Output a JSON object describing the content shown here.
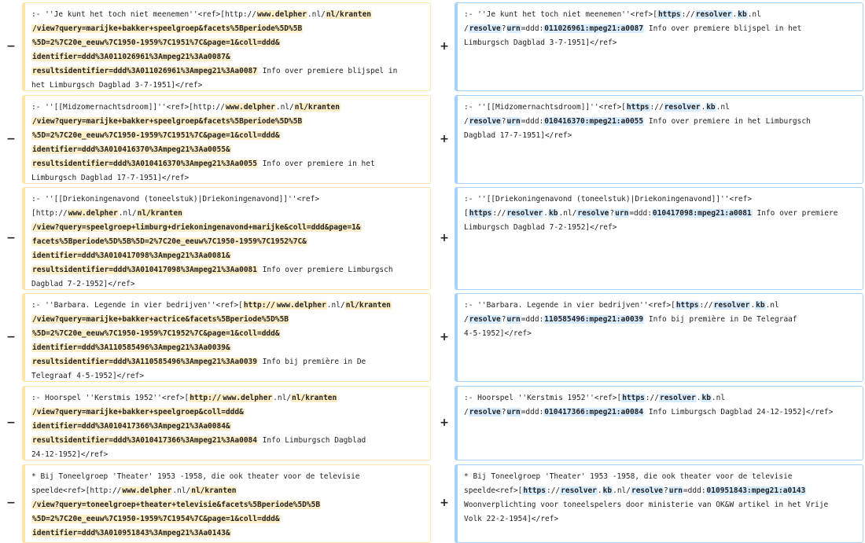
{
  "markers": {
    "minus": "−",
    "plus": "+"
  },
  "rows": [
    {
      "left": [
        [
          {
            "t": ":- ''Je kunt het toch niet meenemen''<ref>["
          },
          {
            "t": "http://",
            "h": 0
          },
          {
            "t": "www.delpher",
            "h": 1
          },
          {
            "t": ".nl/"
          },
          {
            "t": "nl/kranten",
            "h": 1
          }
        ],
        [
          {
            "t": "/view?query=marijke+bakker+speelgroep&facets%5Bperiode%5D%5B",
            "h": 1
          }
        ],
        [
          {
            "t": "%5D=2%7C20e_eeuw%7C1950-1959%7C1951%7C&page=1&coll=ddd&",
            "h": 1
          }
        ],
        [
          {
            "t": "identifier=ddd%3A011026961%3Ampeg21%3Aa0087&",
            "h": 1
          }
        ],
        [
          {
            "t": "resultsidentifier=ddd%3A011026961%3Ampeg21%3Aa0087",
            "h": 1
          },
          {
            "t": " Info over premiere blijspel in"
          }
        ],
        [
          {
            "t": "het Limburgsch Dagblad 3-7-1951]</ref>"
          }
        ]
      ],
      "right": [
        [
          {
            "t": ":- ''Je kunt het toch niet meenemen''<ref>["
          },
          {
            "t": "https",
            "h": 1
          },
          {
            "t": "://"
          },
          {
            "t": "resolver",
            "h": 1
          },
          {
            "t": "."
          },
          {
            "t": "kb",
            "h": 1
          },
          {
            "t": ".nl"
          }
        ],
        [
          {
            "t": "/"
          },
          {
            "t": "resolve",
            "h": 1
          },
          {
            "t": "?"
          },
          {
            "t": "urn",
            "h": 1
          },
          {
            "t": "=ddd:"
          },
          {
            "t": "011026961:mpeg21:a0087",
            "h": 1
          },
          {
            "t": " Info over premiere blijspel in het"
          }
        ],
        [
          {
            "t": "Limburgsch Dagblad 3-7-1951]</ref>"
          }
        ]
      ]
    },
    {
      "left": [
        [
          {
            "t": ":- ''[[Midzomernachtsdroom]]''<ref>["
          },
          {
            "t": "http://"
          },
          {
            "t": "www.delpher",
            "h": 1
          },
          {
            "t": ".nl/"
          },
          {
            "t": "nl/kranten",
            "h": 1
          }
        ],
        [
          {
            "t": "/view?query=marijke+bakker+speelgroep&facets%5Bperiode%5D%5B",
            "h": 1
          }
        ],
        [
          {
            "t": "%5D=2%7C20e_eeuw%7C1950-1959%7C1951%7C&page=1&coll=ddd&",
            "h": 1
          }
        ],
        [
          {
            "t": "identifier=ddd%3A010416370%3Ampeg21%3Aa0055&",
            "h": 1
          }
        ],
        [
          {
            "t": "resultsidentifier=ddd%3A010416370%3Ampeg21%3Aa0055",
            "h": 1
          },
          {
            "t": " Info over premiere in het"
          }
        ],
        [
          {
            "t": "Limburgsch Dagblad 17-7-1951]</ref>"
          }
        ]
      ],
      "right": [
        [
          {
            "t": ":- ''[[Midzomernachtsdroom]]''<ref>["
          },
          {
            "t": "https",
            "h": 1
          },
          {
            "t": "://"
          },
          {
            "t": "resolver",
            "h": 1
          },
          {
            "t": "."
          },
          {
            "t": "kb",
            "h": 1
          },
          {
            "t": ".nl"
          }
        ],
        [
          {
            "t": "/"
          },
          {
            "t": "resolve",
            "h": 1
          },
          {
            "t": "?"
          },
          {
            "t": "urn",
            "h": 1
          },
          {
            "t": "=ddd:"
          },
          {
            "t": "010416370:mpeg21:a0055",
            "h": 1
          },
          {
            "t": " Info over premiere in het Limburgsch"
          }
        ],
        [
          {
            "t": "Dagblad 17-7-1951]</ref>"
          }
        ]
      ]
    },
    {
      "left": [
        [
          {
            "t": ":- ''[[Driekoningenavond (toneelstuk)|Driekoningenavond]]''<ref>"
          }
        ],
        [
          {
            "t": "["
          },
          {
            "t": "http://"
          },
          {
            "t": "www.delpher",
            "h": 1
          },
          {
            "t": ".nl/"
          },
          {
            "t": "nl/kranten",
            "h": 1
          }
        ],
        [
          {
            "t": "/view?query=speelgroep+limburg+driekoningenavond+marijke&coll=ddd&page=1&",
            "h": 1
          }
        ],
        [
          {
            "t": "facets%5Bperiode%5D%5B%5D=2%7C20e_eeuw%7C1950-1959%7C1952%7C&",
            "h": 1
          }
        ],
        [
          {
            "t": "identifier=ddd%3A010417098%3Ampeg21%3Aa0081&",
            "h": 1
          }
        ],
        [
          {
            "t": "resultsidentifier=ddd%3A010417098%3Ampeg21%3Aa0081",
            "h": 1
          },
          {
            "t": " Info over premiere Limburgsch"
          }
        ],
        [
          {
            "t": "Dagblad 7-2-1952]</ref>"
          }
        ]
      ],
      "right": [
        [
          {
            "t": ":- ''[[Driekoningenavond (toneelstuk)|Driekoningenavond]]''<ref>"
          }
        ],
        [
          {
            "t": "["
          },
          {
            "t": "https",
            "h": 1
          },
          {
            "t": "://"
          },
          {
            "t": "resolver",
            "h": 1
          },
          {
            "t": "."
          },
          {
            "t": "kb",
            "h": 1
          },
          {
            "t": ".nl/"
          },
          {
            "t": "resolve",
            "h": 1
          },
          {
            "t": "?"
          },
          {
            "t": "urn",
            "h": 1
          },
          {
            "t": "=ddd:"
          },
          {
            "t": "010417098:mpeg21:a0081",
            "h": 1
          },
          {
            "t": " Info over premiere"
          }
        ],
        [
          {
            "t": "Limburgsch Dagblad 7-2-1952]</ref>"
          }
        ]
      ]
    },
    {
      "left": [
        [
          {
            "t": ":- ''Barbara. Legende in vier bedrijven''<ref>["
          },
          {
            "t": "http://",
            "h": 1
          },
          {
            "t": "www.delpher",
            "h": 1
          },
          {
            "t": ".nl/"
          },
          {
            "t": "nl/kranten",
            "h": 1
          }
        ],
        [
          {
            "t": "/view?query=marijke+bakker+actrice&facets%5Bperiode%5D%5B",
            "h": 1
          }
        ],
        [
          {
            "t": "%5D=2%7C20e_eeuw%7C1950-1959%7C1952%7C&page=1&coll=ddd&",
            "h": 1
          }
        ],
        [
          {
            "t": "identifier=ddd%3A110585496%3Ampeg21%3Aa0039&",
            "h": 1
          }
        ],
        [
          {
            "t": "resultsidentifier=ddd%3A110585496%3Ampeg21%3Aa0039",
            "h": 1
          },
          {
            "t": " Info bij première in De"
          }
        ],
        [
          {
            "t": "Telegraaf 4-5-1952]</ref>"
          }
        ]
      ],
      "right": [
        [
          {
            "t": ":- ''Barbara. Legende in vier bedrijven''<ref>["
          },
          {
            "t": "https",
            "h": 1
          },
          {
            "t": "://"
          },
          {
            "t": "resolver",
            "h": 1
          },
          {
            "t": "."
          },
          {
            "t": "kb",
            "h": 1
          },
          {
            "t": ".nl"
          }
        ],
        [
          {
            "t": "/"
          },
          {
            "t": "resolve",
            "h": 1
          },
          {
            "t": "?"
          },
          {
            "t": "urn",
            "h": 1
          },
          {
            "t": "=ddd:"
          },
          {
            "t": "110585496:mpeg21:a0039",
            "h": 1
          },
          {
            "t": " Info bij première in De Telegraaf"
          }
        ],
        [
          {
            "t": "4-5-1952]</ref>"
          }
        ]
      ]
    },
    {
      "left": [
        [
          {
            "t": ":- Hoorspel ''Kerstmis 1952''<ref>["
          },
          {
            "t": "http://",
            "h": 1
          },
          {
            "t": "www.delpher",
            "h": 1
          },
          {
            "t": ".nl/"
          },
          {
            "t": "nl/kranten",
            "h": 1
          }
        ],
        [
          {
            "t": "/view?query=marijke+bakker+speelgroep&coll=ddd&",
            "h": 1
          }
        ],
        [
          {
            "t": "identifier=ddd%3A010417366%3Ampeg21%3Aa0084&",
            "h": 1
          }
        ],
        [
          {
            "t": "resultsidentifier=ddd%3A010417366%3Ampeg21%3Aa0084",
            "h": 1
          },
          {
            "t": " Info Limburgsch Dagblad"
          }
        ],
        [
          {
            "t": "24-12-1952]</ref>"
          }
        ]
      ],
      "right": [
        [
          {
            "t": ":- Hoorspel ''Kerstmis 1952''<ref>["
          },
          {
            "t": "https",
            "h": 1
          },
          {
            "t": "://"
          },
          {
            "t": "resolver",
            "h": 1
          },
          {
            "t": "."
          },
          {
            "t": "kb",
            "h": 1
          },
          {
            "t": ".nl"
          }
        ],
        [
          {
            "t": "/"
          },
          {
            "t": "resolve",
            "h": 1
          },
          {
            "t": "?"
          },
          {
            "t": "urn",
            "h": 1
          },
          {
            "t": "=ddd:"
          },
          {
            "t": "010417366:mpeg21:a0084",
            "h": 1
          },
          {
            "t": " Info Limburgsch Dagblad 24-12-1952]</ref>"
          }
        ]
      ]
    },
    {
      "left": [
        [
          {
            "t": "* Bij Toneelgroep 'Theater' 1953 -1958, die ook theater voor de televisie"
          }
        ],
        [
          {
            "t": "speelde<ref>["
          },
          {
            "t": "http://"
          },
          {
            "t": "www.delpher",
            "h": 1
          },
          {
            "t": ".nl/"
          },
          {
            "t": "nl/kranten",
            "h": 1
          }
        ],
        [
          {
            "t": "/view?query=toneelgroep+theater+televisie&facets%5Bperiode%5D%5B",
            "h": 1
          }
        ],
        [
          {
            "t": "%5D=2%7C20e_eeuw%7C1950-1959%7C1954%7C&page=1&coll=ddd&",
            "h": 1
          }
        ],
        [
          {
            "t": "identifier=ddd%3A010951843%3Ampeg21%3Aa0143&",
            "h": 1
          }
        ]
      ],
      "right": [
        [
          {
            "t": "* Bij Toneelgroep 'Theater' 1953 -1958, die ook theater voor de televisie"
          }
        ],
        [
          {
            "t": "speelde<ref>["
          },
          {
            "t": "https",
            "h": 1
          },
          {
            "t": "://"
          },
          {
            "t": "resolver",
            "h": 1
          },
          {
            "t": "."
          },
          {
            "t": "kb",
            "h": 1
          },
          {
            "t": ".nl/"
          },
          {
            "t": "resolve",
            "h": 1
          },
          {
            "t": "?"
          },
          {
            "t": "urn",
            "h": 1
          },
          {
            "t": "=ddd:"
          },
          {
            "t": "010951843:mpeg21:a0143",
            "h": 1
          }
        ],
        [
          {
            "t": "Woonverplichting voor toneelspelers door ministerie van OK&W artikel in het Vrije"
          }
        ],
        [
          {
            "t": "Volk 22-2-1954]</ref>"
          }
        ]
      ]
    }
  ]
}
